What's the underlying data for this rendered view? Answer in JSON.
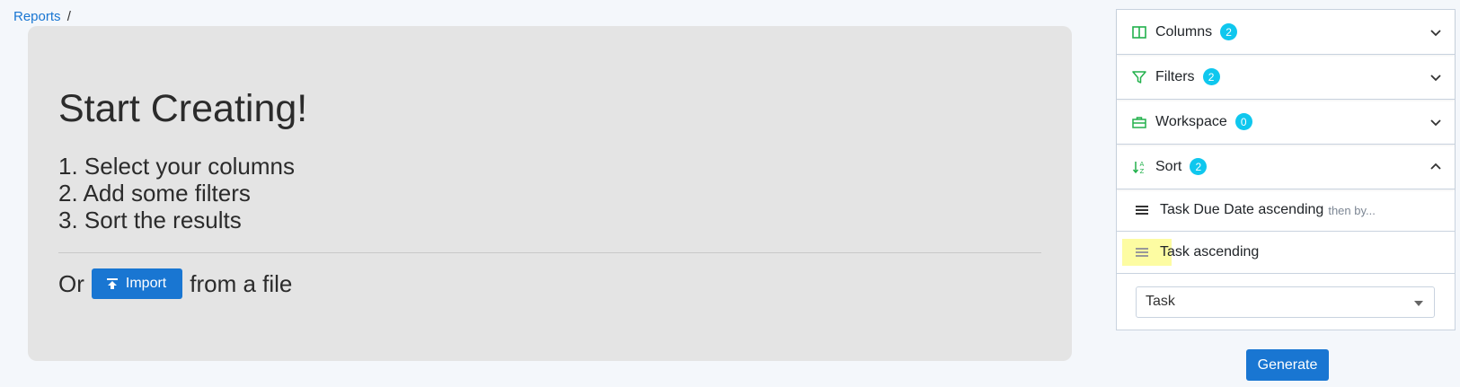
{
  "breadcrumb": {
    "link": "Reports",
    "separator": "/"
  },
  "hero": {
    "title": "Start Creating!",
    "steps": [
      "1. Select your columns",
      "2. Add some filters",
      "3. Sort the results"
    ],
    "import_prefix": "Or",
    "import_button": "Import",
    "import_suffix": "from a file"
  },
  "panel": {
    "sections": [
      {
        "label": "Columns",
        "count": "2",
        "icon": "columns-icon",
        "expanded": false
      },
      {
        "label": "Filters",
        "count": "2",
        "icon": "filter-icon",
        "expanded": false
      },
      {
        "label": "Workspace",
        "count": "0",
        "icon": "briefcase-icon",
        "expanded": false
      },
      {
        "label": "Sort",
        "count": "2",
        "icon": "sort-icon",
        "expanded": true
      }
    ],
    "sort_items": [
      {
        "label": "Task Due Date ascending",
        "suffix": "then by..."
      },
      {
        "label": "Task ascending",
        "suffix": ""
      }
    ],
    "sort_select": {
      "value": "Task"
    }
  },
  "generate_button": "Generate",
  "colors": {
    "accent": "#1976d2",
    "badge": "#0fc7ee",
    "icon_green": "#22b14c",
    "highlight": "#fdfca2"
  }
}
